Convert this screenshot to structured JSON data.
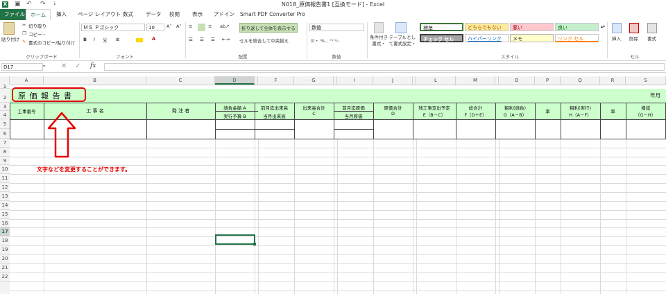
{
  "window": {
    "title": "N018_原価報告書1 [互換モード] - Excel"
  },
  "tabs": [
    "ファイル",
    "ホーム",
    "挿入",
    "ページ レイアウト",
    "数式",
    "データ",
    "校閲",
    "表示",
    "アドイン",
    "Smart PDF Converter Pro"
  ],
  "ribbon": {
    "clipboard": {
      "paste": "貼り付け",
      "cut": "切り取り",
      "copy": "コピー・",
      "format_painter": "書式のコピー/貼り付け",
      "label": "クリップボード"
    },
    "font": {
      "name": "ＭＳ Ｐゴシック",
      "size": "10",
      "bold": "B",
      "italic": "I",
      "underline": "U",
      "label": "フォント"
    },
    "alignment": {
      "wrap": "折り返して全体を表示する",
      "merge": "セルを結合して中央揃え",
      "label": "配置"
    },
    "number": {
      "format": "数値",
      "label": "数値"
    },
    "styles": {
      "conditional": "条件付き書式・",
      "table": "テーブルとして書式設定・",
      "cells": [
        "標準",
        "どちらでもない",
        "悪い",
        "良い",
        "チェック セル",
        "ハイパーリンク",
        "メモ",
        "リンク セル"
      ],
      "label": "スタイル"
    },
    "cells": {
      "insert": "挿入",
      "delete": "削除",
      "format": "書式",
      "label": "セル"
    }
  },
  "formula_bar": {
    "name_box": "D17",
    "fx": "fx",
    "value": ""
  },
  "columns": [
    "A",
    "B",
    "C",
    "D",
    "E",
    "F",
    "G",
    "H",
    "I",
    "J",
    "K",
    "L",
    "M",
    "N",
    "O",
    "P",
    "Q",
    "R",
    "S"
  ],
  "rows": [
    "1",
    "2",
    "3",
    "4",
    "5",
    "6",
    "7",
    "8",
    "9",
    "10",
    "11",
    "12",
    "13",
    "14",
    "15",
    "16",
    "17",
    "18",
    "19",
    "20",
    "21",
    "22"
  ],
  "sheet": {
    "title": "原 価 報 告 書",
    "year_month": "年月",
    "headers": {
      "work_no": "工事番号",
      "work_name": "工 事 名",
      "client": "発 注 者",
      "contract": "請負金額 A",
      "budget": "実行予算 B",
      "prev_done": "前月迄出来高",
      "this_done": "当月出来高",
      "done_total": "出来高合計",
      "done_total_sub": "C",
      "prev_cost": "前月迄原価",
      "this_cost": "当月原価",
      "cost_total": "原価合計",
      "cost_total_sub": "D",
      "remain": "残工事支出予定",
      "remain_sub": "E（B－C）",
      "grand": "総合計",
      "grand_sub": "F（D＋E）",
      "profit_c": "粗利(請負)",
      "profit_c_sub": "G（A－B）",
      "rate1": "率",
      "profit_e": "粗利(実行)",
      "profit_e_sub": "H（A－F）",
      "rate2": "率",
      "diff": "増減",
      "diff_sub": "（G－H）"
    }
  },
  "annotation": {
    "text": "文字などを変更することができます。",
    "color": "#e60000"
  }
}
